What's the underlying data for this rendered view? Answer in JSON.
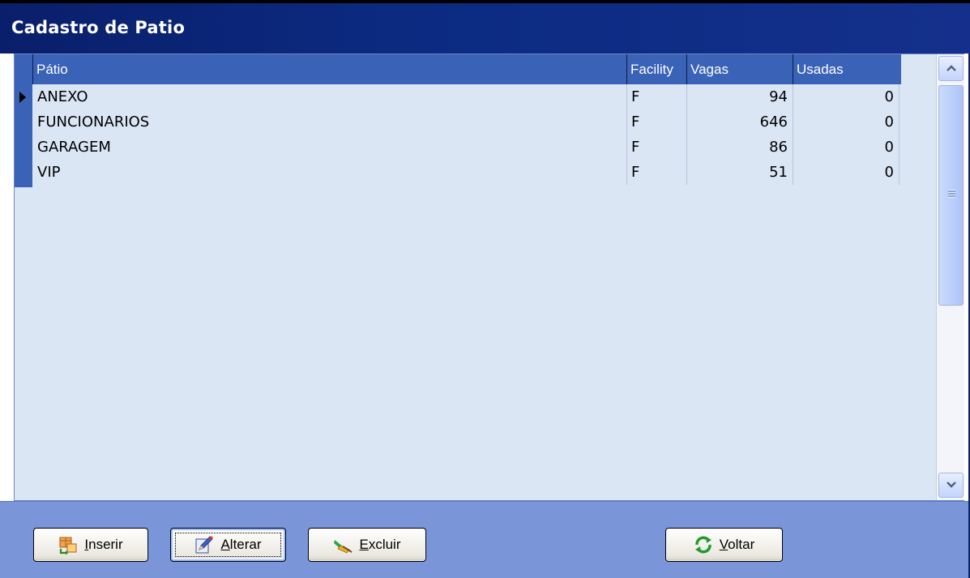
{
  "window": {
    "title": "Cadastro de Patio"
  },
  "grid": {
    "columns": [
      "Pátio",
      "Facility",
      "Vagas",
      "Usadas"
    ],
    "rows": [
      {
        "patio": "ANEXO",
        "facility": "F",
        "vagas": "94",
        "usadas": "0",
        "current": true
      },
      {
        "patio": "FUNCIONARIOS",
        "facility": "F",
        "vagas": "646",
        "usadas": "0",
        "current": false
      },
      {
        "patio": "GARAGEM",
        "facility": "F",
        "vagas": "86",
        "usadas": "0",
        "current": false
      },
      {
        "patio": "VIP",
        "facility": "F",
        "vagas": "51",
        "usadas": "0",
        "current": false
      }
    ]
  },
  "scrollbar": {
    "up_icon": "chevron-up-icon",
    "down_icon": "chevron-down-icon"
  },
  "buttons": {
    "inserir": {
      "label": "Inserir",
      "icon": "insert-table-icon"
    },
    "alterar": {
      "label": "Alterar",
      "icon": "edit-pencil-icon"
    },
    "excluir": {
      "label": "Excluir",
      "icon": "eraser-broom-icon"
    },
    "voltar": {
      "label": "Voltar",
      "icon": "refresh-arrows-icon"
    }
  },
  "colors": {
    "titlebar": "#0a1f6b",
    "grid_header": "#3a62b7",
    "grid_background": "#dbe6f5",
    "button_bar": "#7a95d8"
  }
}
